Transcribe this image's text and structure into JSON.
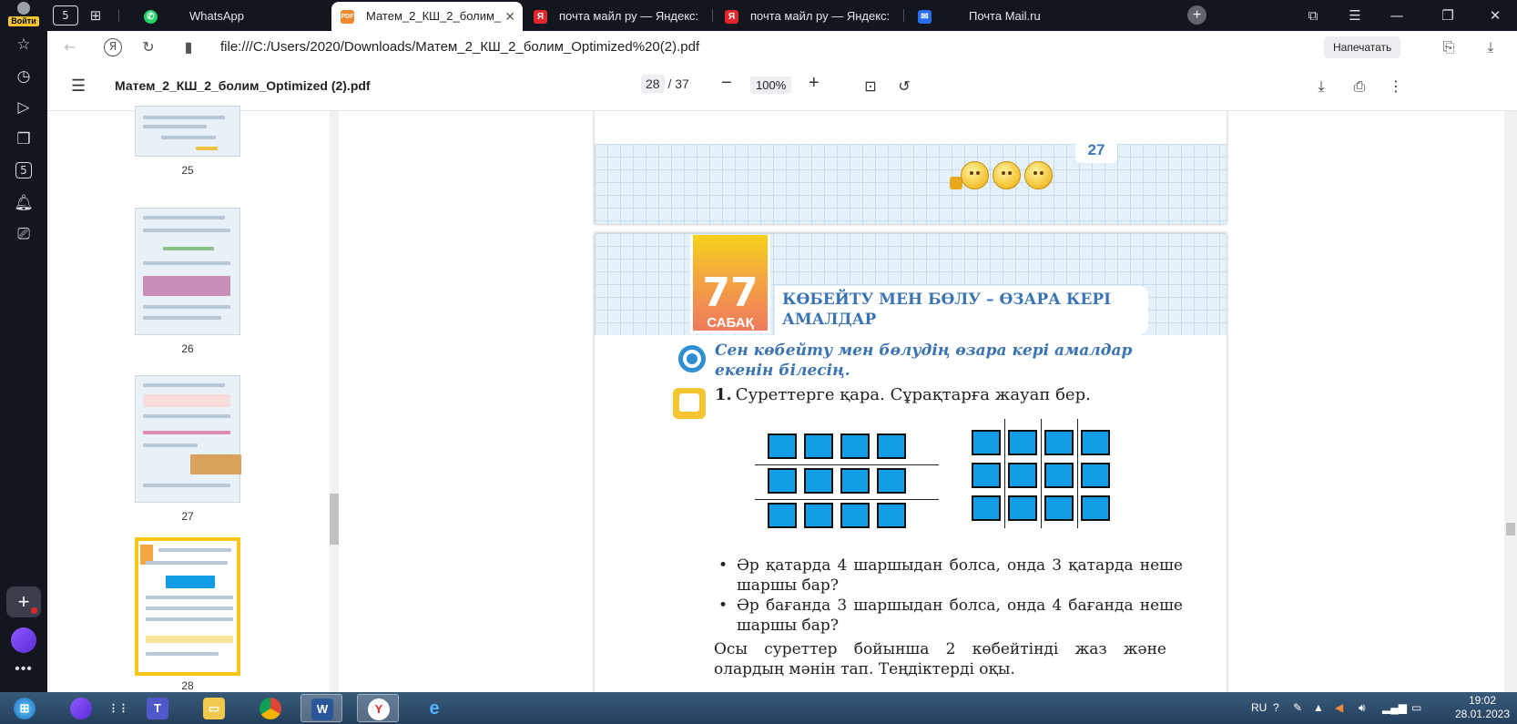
{
  "sidebar": {
    "login_label": "Войти",
    "icons": [
      "star-icon",
      "history-icon",
      "play-icon",
      "collections-icon",
      "counter-icon",
      "bell-icon",
      "screenshot-icon"
    ],
    "counter": "5"
  },
  "tabs": {
    "counter": "5",
    "items": [
      {
        "label": "WhatsApp",
        "icon": "whatsapp-icon",
        "active": false
      },
      {
        "label": "Матем_2_КШ_2_болим_",
        "icon": "pdf-icon",
        "active": true
      },
      {
        "label": "почта майл ру — Яндекс:",
        "icon": "yandex-icon",
        "active": false
      },
      {
        "label": "почта майл ру — Яндекс:",
        "icon": "yandex-icon",
        "active": false
      },
      {
        "label": "Почта Mail.ru",
        "icon": "mail-icon",
        "active": false
      }
    ]
  },
  "address": {
    "url": "file:///C:/Users/2020/Downloads/Матем_2_КШ_2_болим_Optimized%20(2).pdf",
    "print_button": "Напечатать"
  },
  "pdf_toolbar": {
    "title": "Матем_2_КШ_2_болим_Optimized (2).pdf",
    "current_page": "28",
    "total_pages": "/ 37",
    "zoom": "100%"
  },
  "thumbnails": [
    {
      "label": "25"
    },
    {
      "label": "26"
    },
    {
      "label": "27"
    },
    {
      "label": "28"
    }
  ],
  "page_prev": {
    "page_number": "27"
  },
  "page_current": {
    "lesson_number": "77",
    "lesson_word": "САБАҚ",
    "lesson_title": "КӨБЕЙТУ МЕН БӨЛУ – ӨЗАРА КЕРІ АМАЛДАР",
    "goal": "Сен көбейту мен бөлудің өзара кері амалдар екенін білесің.",
    "task_number": "1.",
    "task_text": "Суреттерге қара. Сұрақтарға жауап бер.",
    "bullets": [
      "Әр қатарда 4 шаршыдан болса, онда 3 қатарда неше шаршы бар?",
      "Әр бағанда 3 шаршыдан болса, онда  4  бағанда неше шаршы бар?"
    ],
    "paragraph": "Осы суреттер бойынша 2 көбейтінді жаз және олардың мәнін тап. Теңдіктерді оқы."
  },
  "taskbar": {
    "apps": [
      "windows-start-icon",
      "alice-icon",
      "apps-grid-icon",
      "teams-icon",
      "explorer-icon",
      "chrome-icon",
      "word-icon",
      "yandex-browser-icon",
      "ie-icon"
    ],
    "lang": "RU",
    "time": "19:02",
    "date": "28.01.2023"
  },
  "colors": {
    "accent_blue": "#0f9ee6",
    "title_blue": "#3a73b4",
    "badge_yellow": "#f6d21a",
    "badge_orange": "#ef7a5e"
  }
}
